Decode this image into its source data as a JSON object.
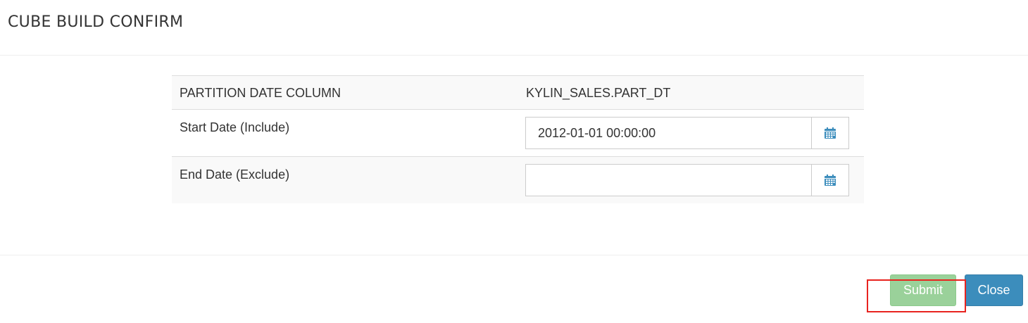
{
  "modal": {
    "title": "CUBE BUILD CONFIRM"
  },
  "table": {
    "partition": {
      "label": "PARTITION DATE COLUMN",
      "value": "KYLIN_SALES.PART_DT"
    },
    "start_date": {
      "label": "Start Date (Include)",
      "value": "2012-01-01 00:00:00",
      "icon": "calendar-icon"
    },
    "end_date": {
      "label": "End Date (Exclude)",
      "value": "",
      "icon": "calendar-icon"
    }
  },
  "footer": {
    "submit_label": "Submit",
    "close_label": "Close"
  },
  "colors": {
    "submit_bg": "#9ad19a",
    "close_bg": "#3c8dbc",
    "highlight": "#e8231f",
    "calendar_icon": "#3c8dbc"
  }
}
